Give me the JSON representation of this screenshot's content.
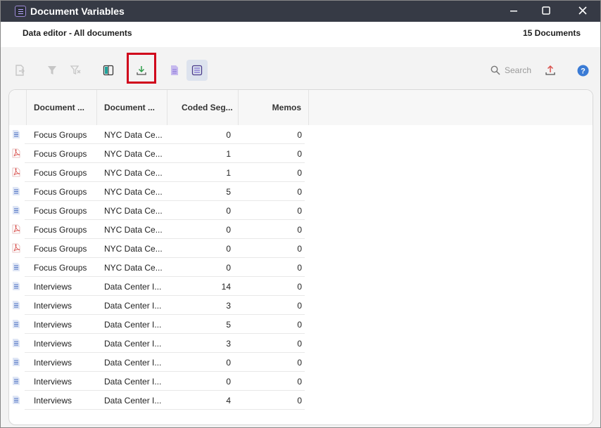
{
  "window": {
    "title": "Document Variables"
  },
  "header": {
    "left": "Data editor - All documents",
    "right": "15 Documents"
  },
  "toolbar": {
    "search_placeholder": "Search"
  },
  "table": {
    "columns": [
      "Document ...",
      "Document ...",
      "Coded Seg...",
      "Memos"
    ],
    "rows": [
      {
        "icon": "text-document-icon",
        "group": "Focus Groups",
        "name": "NYC Data Ce...",
        "coded": "0",
        "memos": "0"
      },
      {
        "icon": "pdf-document-icon",
        "group": "Focus Groups",
        "name": "NYC Data Ce...",
        "coded": "1",
        "memos": "0"
      },
      {
        "icon": "pdf-document-icon",
        "group": "Focus Groups",
        "name": "NYC Data Ce...",
        "coded": "1",
        "memos": "0"
      },
      {
        "icon": "text-document-icon",
        "group": "Focus Groups",
        "name": "NYC Data Ce...",
        "coded": "5",
        "memos": "0"
      },
      {
        "icon": "text-document-icon",
        "group": "Focus Groups",
        "name": "NYC Data Ce...",
        "coded": "0",
        "memos": "0"
      },
      {
        "icon": "pdf-document-icon",
        "group": "Focus Groups",
        "name": "NYC Data Ce...",
        "coded": "0",
        "memos": "0"
      },
      {
        "icon": "pdf-document-icon",
        "group": "Focus Groups",
        "name": "NYC Data Ce...",
        "coded": "0",
        "memos": "0"
      },
      {
        "icon": "text-document-icon",
        "group": "Focus Groups",
        "name": "NYC Data Ce...",
        "coded": "0",
        "memos": "0"
      },
      {
        "icon": "text-document-icon",
        "group": "Interviews",
        "name": "Data Center I...",
        "coded": "14",
        "memos": "0"
      },
      {
        "icon": "text-document-icon",
        "group": "Interviews",
        "name": "Data Center I...",
        "coded": "3",
        "memos": "0"
      },
      {
        "icon": "text-document-icon",
        "group": "Interviews",
        "name": "Data Center I...",
        "coded": "5",
        "memos": "0"
      },
      {
        "icon": "text-document-icon",
        "group": "Interviews",
        "name": "Data Center I...",
        "coded": "3",
        "memos": "0"
      },
      {
        "icon": "text-document-icon",
        "group": "Interviews",
        "name": "Data Center I...",
        "coded": "0",
        "memos": "0"
      },
      {
        "icon": "text-document-icon",
        "group": "Interviews",
        "name": "Data Center I...",
        "coded": "0",
        "memos": "0"
      },
      {
        "icon": "text-document-icon",
        "group": "Interviews",
        "name": "Data Center I...",
        "coded": "4",
        "memos": "0"
      }
    ]
  },
  "colors": {
    "titlebar": "#363a45",
    "highlight": "#d0021b",
    "accent": "#3a7bd5",
    "pdf": "#d9534f",
    "export_green": "#2e9e4a"
  }
}
